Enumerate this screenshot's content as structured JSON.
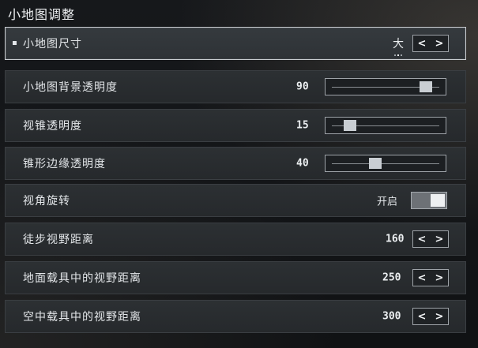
{
  "title": "小地图调整",
  "rows": [
    {
      "label": "小地图尺寸",
      "type": "select",
      "value": "大"
    },
    {
      "label": "小地图背景透明度",
      "type": "slider",
      "value": "90",
      "fraction": 0.9
    },
    {
      "label": "视锥透明度",
      "type": "slider",
      "value": "15",
      "fraction": 0.15
    },
    {
      "label": "锥形边缘透明度",
      "type": "slider",
      "value": "40",
      "fraction": 0.4
    },
    {
      "label": "视角旋转",
      "type": "toggle",
      "value": "开启",
      "on": true
    },
    {
      "label": "徒步视野距离",
      "type": "stepper",
      "value": "160"
    },
    {
      "label": "地面载具中的视野距离",
      "type": "stepper",
      "value": "250"
    },
    {
      "label": "空中载具中的视野距离",
      "type": "stepper",
      "value": "300"
    }
  ],
  "arrow_left": "<",
  "arrow_right": ">",
  "icons": {
    "left": "chevron-left-icon",
    "right": "chevron-right-icon"
  }
}
